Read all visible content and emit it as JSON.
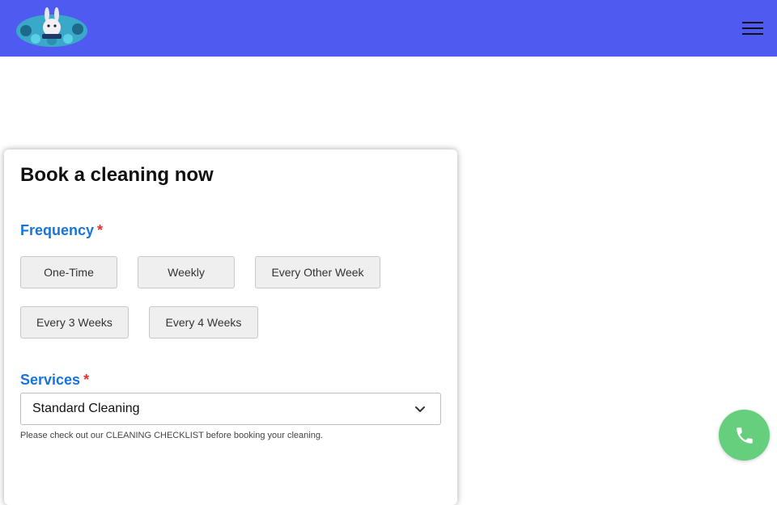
{
  "header": {
    "logo_icon": "rabbit-mascot-logo-icon",
    "menu_icon": "hamburger-menu-icon"
  },
  "booking": {
    "title": "Book a cleaning now",
    "frequency": {
      "label": "Frequency",
      "required_mark": "*",
      "options": [
        "One-Time",
        "Weekly",
        "Every Other Week",
        "Every 3 Weeks",
        "Every 4 Weeks"
      ]
    },
    "services": {
      "label": "Services",
      "required_mark": "*",
      "selected": "Standard Cleaning",
      "dropdown_icon": "chevron-down-icon"
    },
    "note": "Please check out our CLEANING CHECKLIST before booking your cleaning."
  },
  "call": {
    "icon": "phone-icon"
  },
  "colors": {
    "header_bg": "#4f5bf0",
    "label_blue": "#1a73d9",
    "required_red": "#e03131",
    "call_green": "#66cf7e"
  }
}
